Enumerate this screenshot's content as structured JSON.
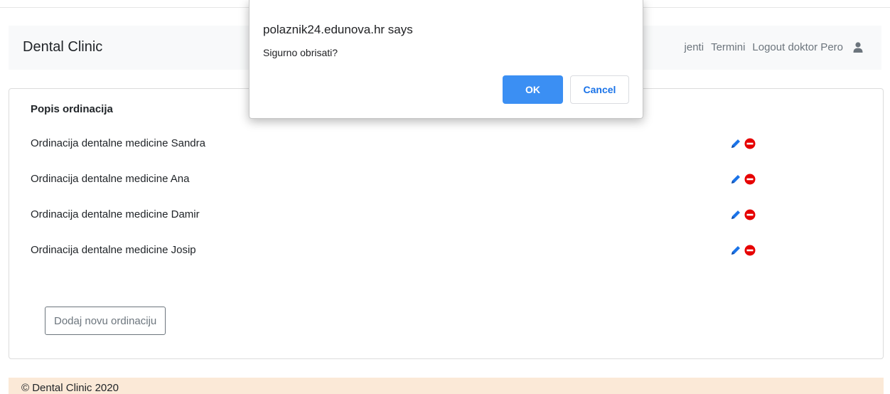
{
  "navbar": {
    "brand": "Dental Clinic",
    "links": [
      "jenti",
      "Termini",
      "Logout doktor Pero"
    ]
  },
  "card": {
    "title": "Popis ordinacija",
    "rows": [
      {
        "label": "Ordinacija dentalne medicine Sandra"
      },
      {
        "label": "Ordinacija dentalne medicine Ana"
      },
      {
        "label": "Ordinacija dentalne medicine Damir"
      },
      {
        "label": "Ordinacija dentalne medicine Josip"
      }
    ],
    "add_button": "Dodaj novu ordinaciju"
  },
  "footer": {
    "text": "© Dental Clinic 2020"
  },
  "dialog": {
    "title": "polaznik24.edunova.hr says",
    "message": "Sigurno obrisati?",
    "ok_label": "OK",
    "cancel_label": "Cancel"
  },
  "colors": {
    "edit_icon": "#1a73e8",
    "delete_icon": "#e60000",
    "ok_button": "#3b8ff3",
    "footer_bg": "#fbe9d7"
  },
  "icons": {
    "edit": "pencil-icon",
    "delete": "minus-circle-icon",
    "user": "user-icon"
  }
}
